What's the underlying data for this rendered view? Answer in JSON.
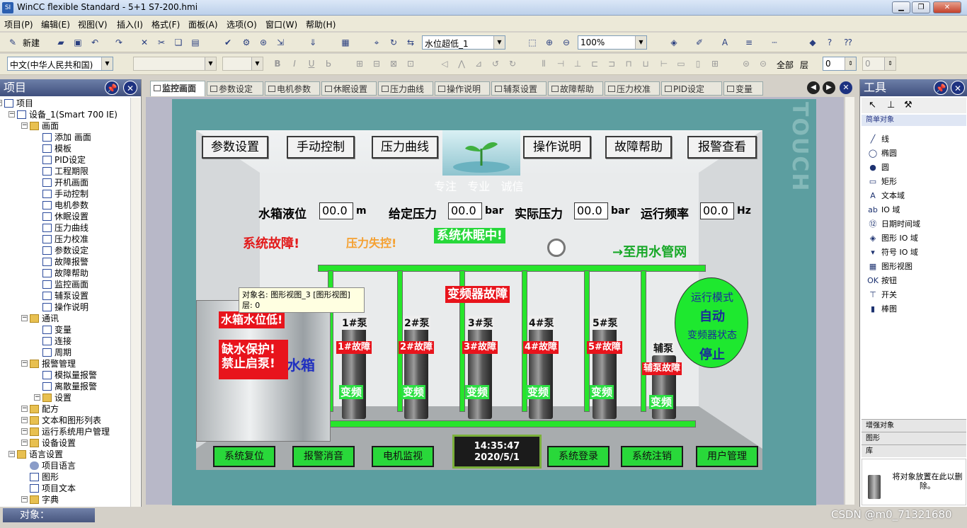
{
  "window": {
    "title": "WinCC flexible Standard - 5+1 S7-200.hmi",
    "app_icon": "SI"
  },
  "menu": [
    "项目(P)",
    "编辑(E)",
    "视图(V)",
    "插入(I)",
    "格式(F)",
    "面板(A)",
    "选项(O)",
    "窗口(W)",
    "帮助(H)"
  ],
  "toolbar1": {
    "new_label": "新建",
    "object_combo": "水位超低_1",
    "zoom_combo": "100%"
  },
  "toolbar2": {
    "language_combo": "中文(中华人民共和国)",
    "font_b": "B",
    "font_i": "I",
    "font_u": "U",
    "font_s": "Ь",
    "layer_all": "全部",
    "layer_label": "层",
    "layer_value": "0",
    "layer_value2": "0"
  },
  "project_pane": {
    "title": "项目",
    "tree": [
      {
        "label": "项目",
        "level": 0,
        "icon": "project"
      },
      {
        "label": "设备_1(Smart 700 IE)",
        "level": 1,
        "icon": "device"
      },
      {
        "label": "画面",
        "level": 2,
        "icon": "folder"
      },
      {
        "label": "添加 画面",
        "level": 3,
        "icon": "add"
      },
      {
        "label": "模板",
        "level": 3,
        "icon": "template"
      },
      {
        "label": "PID设定",
        "level": 3,
        "icon": "page"
      },
      {
        "label": "工程期限",
        "level": 3,
        "icon": "page"
      },
      {
        "label": "开机画面",
        "level": 3,
        "icon": "page"
      },
      {
        "label": "手动控制",
        "level": 3,
        "icon": "page"
      },
      {
        "label": "电机参数",
        "level": 3,
        "icon": "page"
      },
      {
        "label": "休眠设置",
        "level": 3,
        "icon": "page"
      },
      {
        "label": "压力曲线",
        "level": 3,
        "icon": "page"
      },
      {
        "label": "压力校准",
        "level": 3,
        "icon": "page"
      },
      {
        "label": "参数设定",
        "level": 3,
        "icon": "page"
      },
      {
        "label": "故障报警",
        "level": 3,
        "icon": "page"
      },
      {
        "label": "故障帮助",
        "level": 3,
        "icon": "page"
      },
      {
        "label": "监控画面",
        "level": 3,
        "icon": "page"
      },
      {
        "label": "辅泵设置",
        "level": 3,
        "icon": "page"
      },
      {
        "label": "操作说明",
        "level": 3,
        "icon": "page"
      },
      {
        "label": "通讯",
        "level": 2,
        "icon": "folder"
      },
      {
        "label": "变量",
        "level": 3,
        "icon": "var"
      },
      {
        "label": "连接",
        "level": 3,
        "icon": "conn"
      },
      {
        "label": "周期",
        "level": 3,
        "icon": "cycle"
      },
      {
        "label": "报警管理",
        "level": 2,
        "icon": "folder"
      },
      {
        "label": "模拟量报警",
        "level": 3,
        "icon": "alarm"
      },
      {
        "label": "离散量报警",
        "level": 3,
        "icon": "alarm"
      },
      {
        "label": "设置",
        "level": 3,
        "icon": "folder"
      },
      {
        "label": "配方",
        "level": 2,
        "icon": "folder"
      },
      {
        "label": "文本和图形列表",
        "level": 2,
        "icon": "folder"
      },
      {
        "label": "运行系统用户管理",
        "level": 2,
        "icon": "folder"
      },
      {
        "label": "设备设置",
        "level": 2,
        "icon": "folder"
      },
      {
        "label": "语言设置",
        "level": 1,
        "icon": "folder"
      },
      {
        "label": "项目语言",
        "level": 2,
        "icon": "globe"
      },
      {
        "label": "图形",
        "level": 2,
        "icon": "page"
      },
      {
        "label": "项目文本",
        "level": 2,
        "icon": "page"
      },
      {
        "label": "字典",
        "level": 2,
        "icon": "folder"
      }
    ]
  },
  "tabs": [
    "监控画面",
    "参数设定",
    "电机参数",
    "休眠设置",
    "压力曲线",
    "操作说明",
    "辅泵设置",
    "故障帮助",
    "压力校准",
    "PID设定",
    "变量"
  ],
  "device_brand": "TOUCH",
  "hmi": {
    "top_buttons": [
      "参数设置",
      "手动控制",
      "压力曲线",
      "操作说明",
      "故障帮助",
      "报警查看"
    ],
    "slogan": "专注   专业   诚信",
    "fields": [
      {
        "label": "水箱液位",
        "value": "00.0",
        "unit": "m"
      },
      {
        "label": "给定压力",
        "value": "00.0",
        "unit": "bar"
      },
      {
        "label": "实际压力",
        "value": "00.0",
        "unit": "bar"
      },
      {
        "label": "运行频率",
        "value": "00.0",
        "unit": "Hz"
      }
    ],
    "system_fault": "系统故障!",
    "pressure_loss": "压力失控!",
    "sleeping": "系统休眠中!",
    "to_network": "→至用水管网",
    "vfd_fault": "变频器故障",
    "tooltip_line1": "对象名: 图形视图_3 [图形视图]",
    "tooltip_line2": "层: 0",
    "low_water": "水箱水位低!",
    "protect": "缺水保护!\n禁止启泵!",
    "tank_label": "水箱",
    "pumps": [
      {
        "name": "1#泵",
        "fault": "1#故障",
        "mode": "变频"
      },
      {
        "name": "2#泵",
        "fault": "2#故障",
        "mode": "变频"
      },
      {
        "name": "3#泵",
        "fault": "3#故障",
        "mode": "变频"
      },
      {
        "name": "4#泵",
        "fault": "4#故障",
        "mode": "变频"
      },
      {
        "name": "5#泵",
        "fault": "5#故障",
        "mode": "变频"
      }
    ],
    "aux_pump": {
      "name": "辅泵",
      "fault": "辅泵故障",
      "mode": "变频"
    },
    "status_circle": {
      "run_mode_label": "运行模式",
      "run_mode": "自动",
      "vfd_label": "变频器状态",
      "vfd_state": "停止"
    },
    "bottom_buttons": [
      "系统复位",
      "报警消音",
      "电机监视",
      "系统登录",
      "系统注销",
      "用户管理"
    ],
    "clock_time": "14:35:47",
    "clock_date": "2020/5/1"
  },
  "tools_pane": {
    "title": "工具",
    "section": "简单对象",
    "items": [
      "线",
      "椭圆",
      "圆",
      "矩形",
      "文本域",
      "IO 域",
      "日期时间域",
      "图形 IO 域",
      "符号 IO 域",
      "图形视图",
      "按钮",
      "开关",
      "棒图"
    ],
    "groups": [
      "增强对象",
      "图形",
      "库"
    ],
    "hint": "将对象放置在此以删除。"
  },
  "status": {
    "objects_label": "对象：",
    "watermark": "CSDN @m0_71321680"
  }
}
